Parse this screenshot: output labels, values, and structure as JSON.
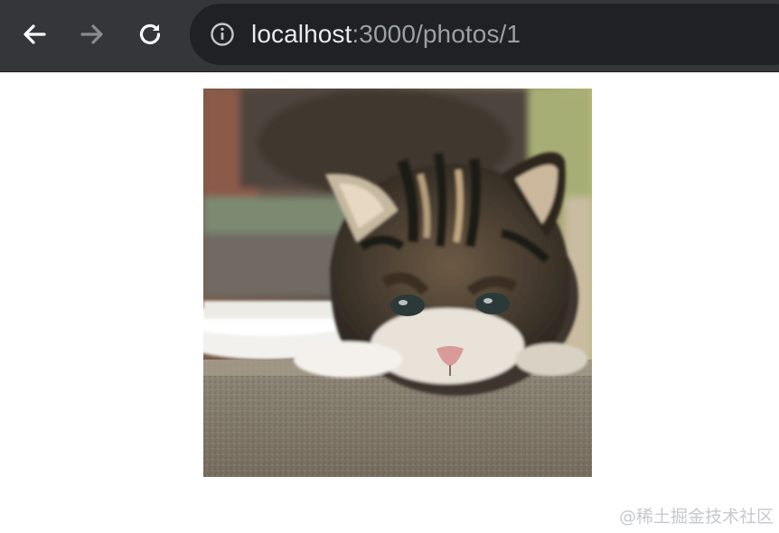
{
  "browser": {
    "url_host": "localhost",
    "url_rest": ":3000/photos/1",
    "icons": {
      "back": "back-arrow-icon",
      "forward": "forward-arrow-icon",
      "reload": "reload-icon",
      "site_info": "info-icon"
    },
    "colors": {
      "toolbar": "#35363a",
      "omnibox": "#202124",
      "url_host": "#e8eaed",
      "url_rest": "#9aa0a6",
      "forward_disabled": "#8a8b8e"
    }
  },
  "page": {
    "photo": {
      "subject": "kitten-photo"
    },
    "watermark": "@稀土掘金技术社区"
  }
}
